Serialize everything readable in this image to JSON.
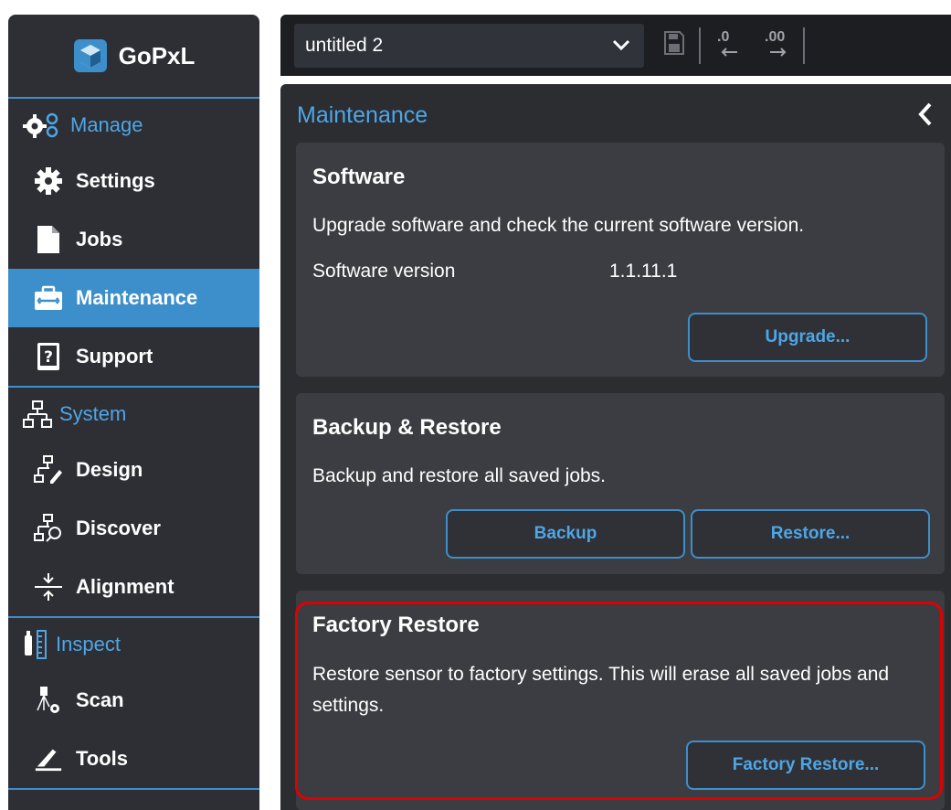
{
  "app": {
    "name": "GoPxL"
  },
  "sidebar": {
    "sections": [
      {
        "label": "Manage",
        "icon": "gears-icon",
        "items": [
          {
            "label": "Settings",
            "icon": "gear-icon"
          },
          {
            "label": "Jobs",
            "icon": "document-icon"
          },
          {
            "label": "Maintenance",
            "icon": "toolbox-icon",
            "active": true
          },
          {
            "label": "Support",
            "icon": "help-book-icon"
          }
        ]
      },
      {
        "label": "System",
        "icon": "network-icon",
        "items": [
          {
            "label": "Design",
            "icon": "design-network-icon"
          },
          {
            "label": "Discover",
            "icon": "discover-network-icon"
          },
          {
            "label": "Alignment",
            "icon": "alignment-icon"
          }
        ]
      },
      {
        "label": "Inspect",
        "icon": "inspect-icon",
        "items": [
          {
            "label": "Scan",
            "icon": "scan-icon"
          },
          {
            "label": "Tools",
            "icon": "tools-icon"
          }
        ]
      }
    ]
  },
  "topbar": {
    "job_select": {
      "value": "untitled 2"
    },
    "icons": [
      "chevron-down-icon",
      "save-icon",
      "decrease-decimals-icon",
      "increase-decimals-icon"
    ],
    "decimal_labels": [
      ".0",
      ".00"
    ]
  },
  "panel": {
    "title": "Maintenance",
    "software": {
      "title": "Software",
      "description": "Upgrade software and check the current software version.",
      "version_label": "Software version",
      "version_value": "1.1.11.1",
      "upgrade_button": "Upgrade..."
    },
    "backup": {
      "title": "Backup & Restore",
      "description": "Backup and restore all saved jobs.",
      "backup_button": "Backup",
      "restore_button": "Restore..."
    },
    "factory": {
      "title": "Factory Restore",
      "description": "Restore sensor to factory settings. This will erase all saved jobs and settings.",
      "button": "Factory Restore..."
    }
  },
  "colors": {
    "accent": "#3d8fcc",
    "accent_text": "#4ea6e6",
    "sidebar_bg": "#2d2f35",
    "card_bg": "#3b3d42",
    "highlight": "#e00000"
  }
}
